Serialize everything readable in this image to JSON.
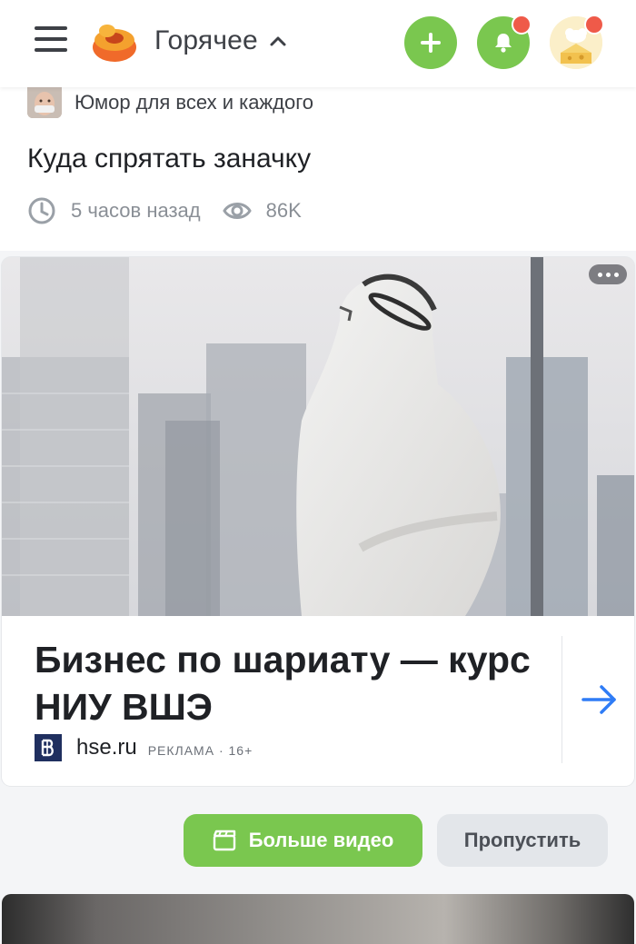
{
  "header": {
    "section_title": "Горячее"
  },
  "post": {
    "community_name": "Юмор для всех и каждого",
    "title": "Куда спрятать заначку",
    "time_ago": "5 часов назад",
    "views": "86K"
  },
  "ad": {
    "title": "Бизнес по шариату — курс НИУ ВШЭ",
    "domain": "hse.ru",
    "label": "РЕКЛАМА · 16+"
  },
  "actions": {
    "more_video_label": "Больше видео",
    "skip_label": "Пропустить"
  },
  "colors": {
    "accent_green": "#7ac74f",
    "badge_red": "#ef5a49",
    "link_blue": "#2f7cf6"
  }
}
